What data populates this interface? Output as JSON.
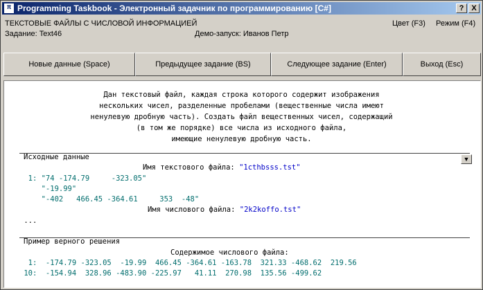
{
  "window": {
    "title": "Programming Taskbook - Электронный задачник по программированию [C#]",
    "help_button": "?",
    "close_button": "X"
  },
  "info": {
    "group": "ТЕКСТОВЫЕ ФАЙЛЫ С ЧИСЛОВОЙ ИНФОРМАЦИЕЙ",
    "color_label": "Цвет (F3)",
    "mode_label": "Режим (F4)",
    "task": "Задание: Text46",
    "demo": "Демо-запуск: Иванов Петр"
  },
  "buttons": {
    "new_data": "Новые данные (Space)",
    "prev_task": "Предыдущее задание (BS)",
    "next_task": "Следующее задание (Enter)",
    "exit": "Выход (Esc)"
  },
  "description": [
    "Дан текстовый файл, каждая строка которого содержит изображения",
    "нескольких чисел, разделенные пробелами (вещественные числа имеют",
    "ненулевую дробную часть). Создать файл вещественных чисел, содержащий",
    "(в том же порядке) все числа из исходного файла,",
    "имеющие ненулевую дробную часть."
  ],
  "source": {
    "header": "Исходные данные",
    "text_file_label": "Имя текстового файла: ",
    "text_file_name": "\"1cthbsss.tst\"",
    "lines": [
      "  1: \"74 -174.79     -323.05\"",
      "     \"-19.99\"",
      "     \"-402   466.45 -364.61     353  -48\""
    ],
    "num_file_label": "Имя числового файла: ",
    "num_file_name": "\"2k2koffo.tst\"",
    "ellipsis": " ..."
  },
  "example": {
    "header": "Пример верного решения",
    "contents_label": "Содержимое числового файла:",
    "rows": [
      "  1:  -174.79 -323.05  -19.99  466.45 -364.61 -163.78  321.33 -468.62  219.56",
      " 10:  -154.94  328.96 -483.90 -225.97   41.11  270.98  135.56 -499.62"
    ]
  },
  "colors": {
    "title_gradient_start": "#0a246a",
    "title_gradient_end": "#a6caf0",
    "number_color": "#006d6d",
    "filename_color": "#0000c8"
  }
}
